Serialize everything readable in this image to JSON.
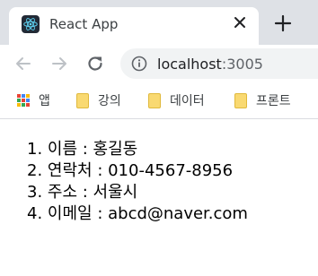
{
  "browser": {
    "tab": {
      "title": "React App",
      "close_icon": "close-icon",
      "favicon": "react-logo-icon"
    },
    "new_tab_icon": "plus-icon",
    "toolbar": {
      "back_icon": "back-arrow-icon",
      "forward_icon": "forward-arrow-icon",
      "reload_icon": "reload-icon",
      "site_info_icon": "info-icon",
      "url_host": "localhost",
      "url_port": ":3005"
    },
    "bookmarks": [
      {
        "label": "앱",
        "icon": "apps-grid-icon"
      },
      {
        "label": "강의",
        "icon": "folder-icon"
      },
      {
        "label": "데이터",
        "icon": "folder-icon"
      },
      {
        "label": "프론트",
        "icon": "folder-icon"
      }
    ]
  },
  "page": {
    "items": [
      {
        "number": "1.",
        "text": "이름 : 홍길동"
      },
      {
        "number": "2.",
        "text": "연락처 : 010-4567-8956"
      },
      {
        "number": "3.",
        "text": "주소 : 서울시"
      },
      {
        "number": "4.",
        "text": "이메일 : abcd@naver.com"
      }
    ]
  },
  "colors": {
    "tabstrip_bg": "#dee1e6",
    "omnibox_bg": "#f1f3f4",
    "react_blue": "#61dafb",
    "folder_yellow": "#f9d971"
  }
}
